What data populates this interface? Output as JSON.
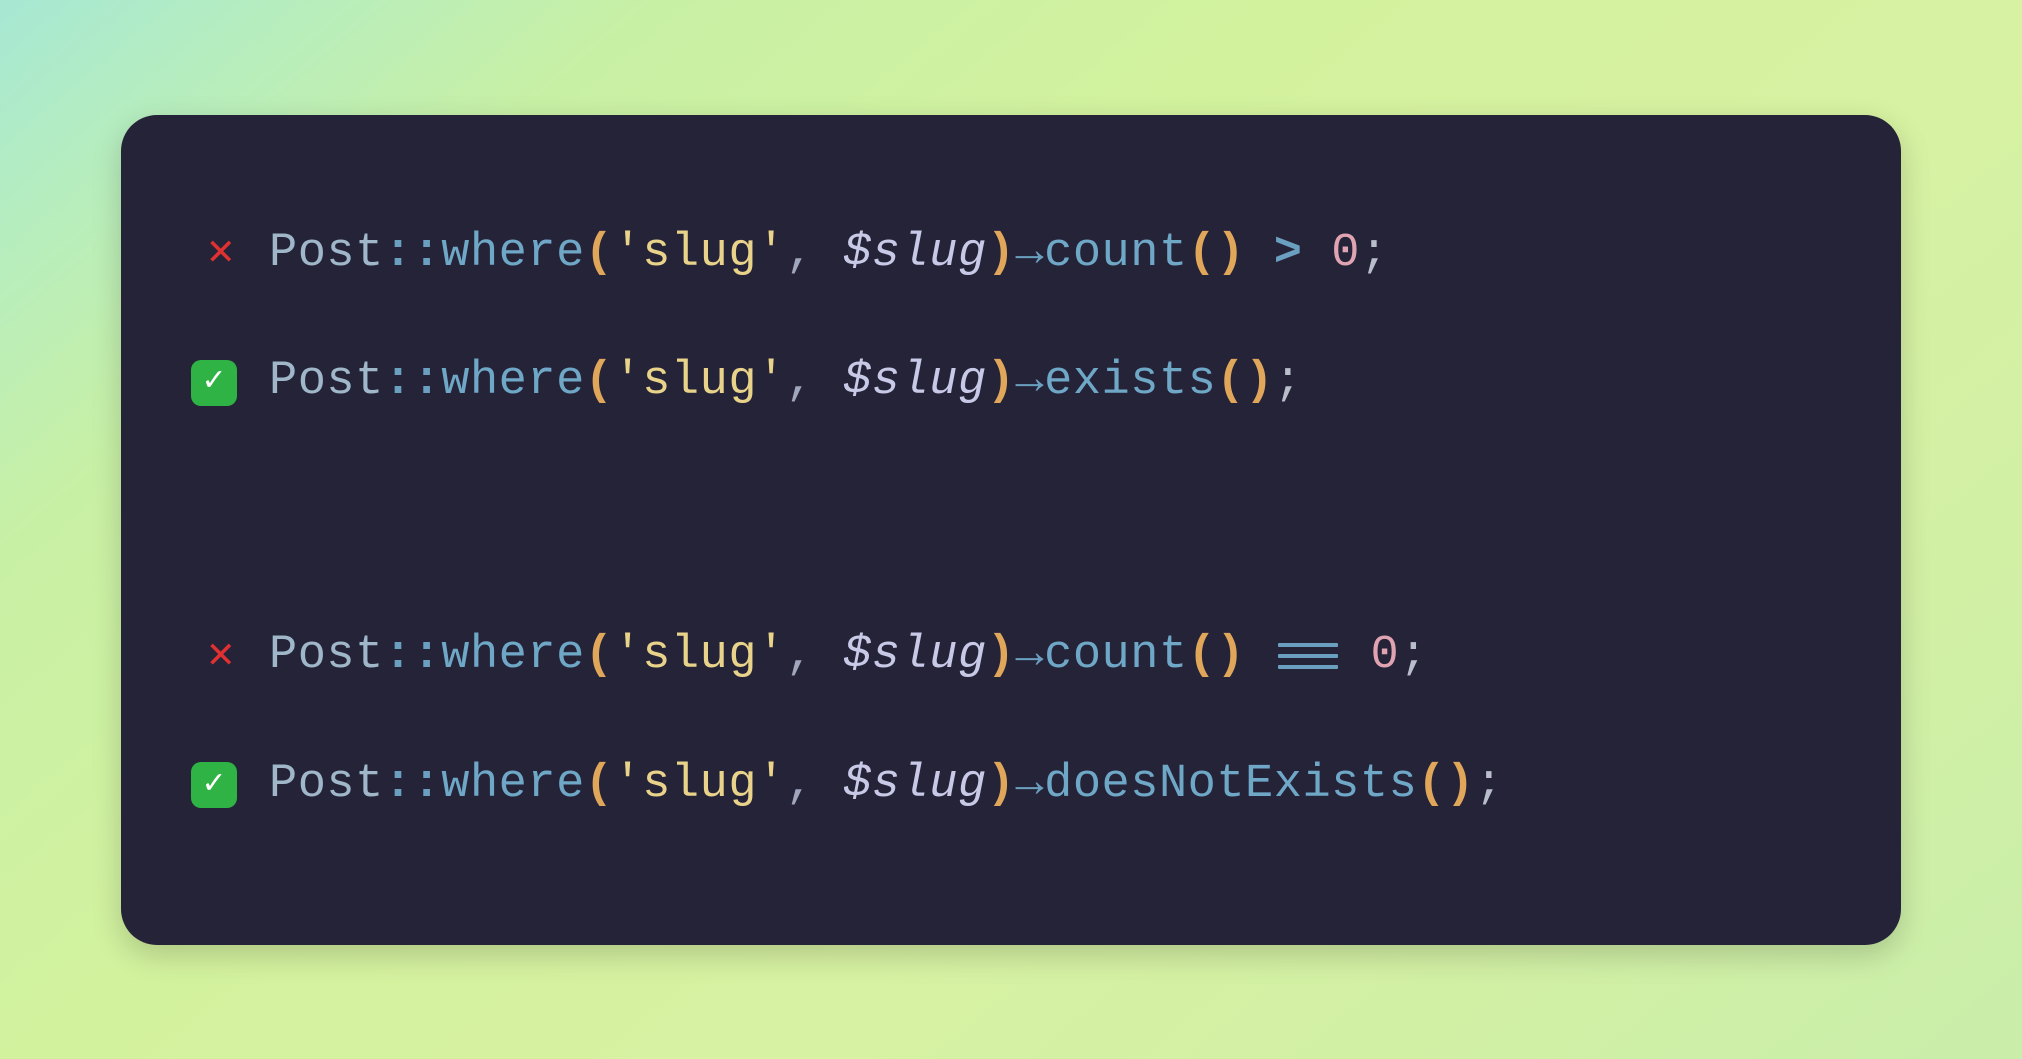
{
  "lines": [
    {
      "status": "bad",
      "segments": [
        {
          "cls": "c-class",
          "text": "Post"
        },
        {
          "cls": "c-scope",
          "text": "::"
        },
        {
          "cls": "c-method",
          "text": "where"
        },
        {
          "cls": "c-paren",
          "text": "("
        },
        {
          "cls": "c-string",
          "text": "'slug'"
        },
        {
          "cls": "c-punct",
          "text": ", "
        },
        {
          "cls": "c-var",
          "text": "$slug"
        },
        {
          "cls": "c-paren",
          "text": ")"
        },
        {
          "cls": "c-arrow",
          "text": "→"
        },
        {
          "cls": "c-method",
          "text": "count"
        },
        {
          "cls": "c-paren",
          "text": "()"
        },
        {
          "cls": "c-op",
          "text": " > "
        },
        {
          "cls": "c-num",
          "text": "0"
        },
        {
          "cls": "c-punct2",
          "text": ";"
        }
      ]
    },
    {
      "status": "good",
      "segments": [
        {
          "cls": "c-class",
          "text": "Post"
        },
        {
          "cls": "c-scope",
          "text": "::"
        },
        {
          "cls": "c-method",
          "text": "where"
        },
        {
          "cls": "c-paren",
          "text": "("
        },
        {
          "cls": "c-string",
          "text": "'slug'"
        },
        {
          "cls": "c-punct",
          "text": ", "
        },
        {
          "cls": "c-var",
          "text": "$slug"
        },
        {
          "cls": "c-paren",
          "text": ")"
        },
        {
          "cls": "c-arrow",
          "text": "→"
        },
        {
          "cls": "c-method",
          "text": "exists"
        },
        {
          "cls": "c-paren",
          "text": "()"
        },
        {
          "cls": "c-punct2",
          "text": ";"
        }
      ]
    },
    {
      "status": "bad",
      "segments": [
        {
          "cls": "c-class",
          "text": "Post"
        },
        {
          "cls": "c-scope",
          "text": "::"
        },
        {
          "cls": "c-method",
          "text": "where"
        },
        {
          "cls": "c-paren",
          "text": "("
        },
        {
          "cls": "c-string",
          "text": "'slug'"
        },
        {
          "cls": "c-punct",
          "text": ", "
        },
        {
          "cls": "c-var",
          "text": "$slug"
        },
        {
          "cls": "c-paren",
          "text": ")"
        },
        {
          "cls": "c-arrow",
          "text": "→"
        },
        {
          "cls": "c-method",
          "text": "count"
        },
        {
          "cls": "c-paren",
          "text": "()"
        },
        {
          "cls": "c-punct",
          "text": " "
        },
        {
          "cls": "triple",
          "text": "==="
        },
        {
          "cls": "c-punct",
          "text": " "
        },
        {
          "cls": "c-num",
          "text": "0"
        },
        {
          "cls": "c-punct2",
          "text": ";"
        }
      ]
    },
    {
      "status": "good",
      "segments": [
        {
          "cls": "c-class",
          "text": "Post"
        },
        {
          "cls": "c-scope",
          "text": "::"
        },
        {
          "cls": "c-method",
          "text": "where"
        },
        {
          "cls": "c-paren",
          "text": "("
        },
        {
          "cls": "c-string",
          "text": "'slug'"
        },
        {
          "cls": "c-punct",
          "text": ", "
        },
        {
          "cls": "c-var",
          "text": "$slug"
        },
        {
          "cls": "c-paren",
          "text": ")"
        },
        {
          "cls": "c-arrow",
          "text": "→"
        },
        {
          "cls": "c-method",
          "text": "doesNotExists"
        },
        {
          "cls": "c-paren",
          "text": "()"
        },
        {
          "cls": "c-punct2",
          "text": ";"
        }
      ]
    }
  ],
  "icons": {
    "bad": "✕",
    "good": "✓"
  }
}
